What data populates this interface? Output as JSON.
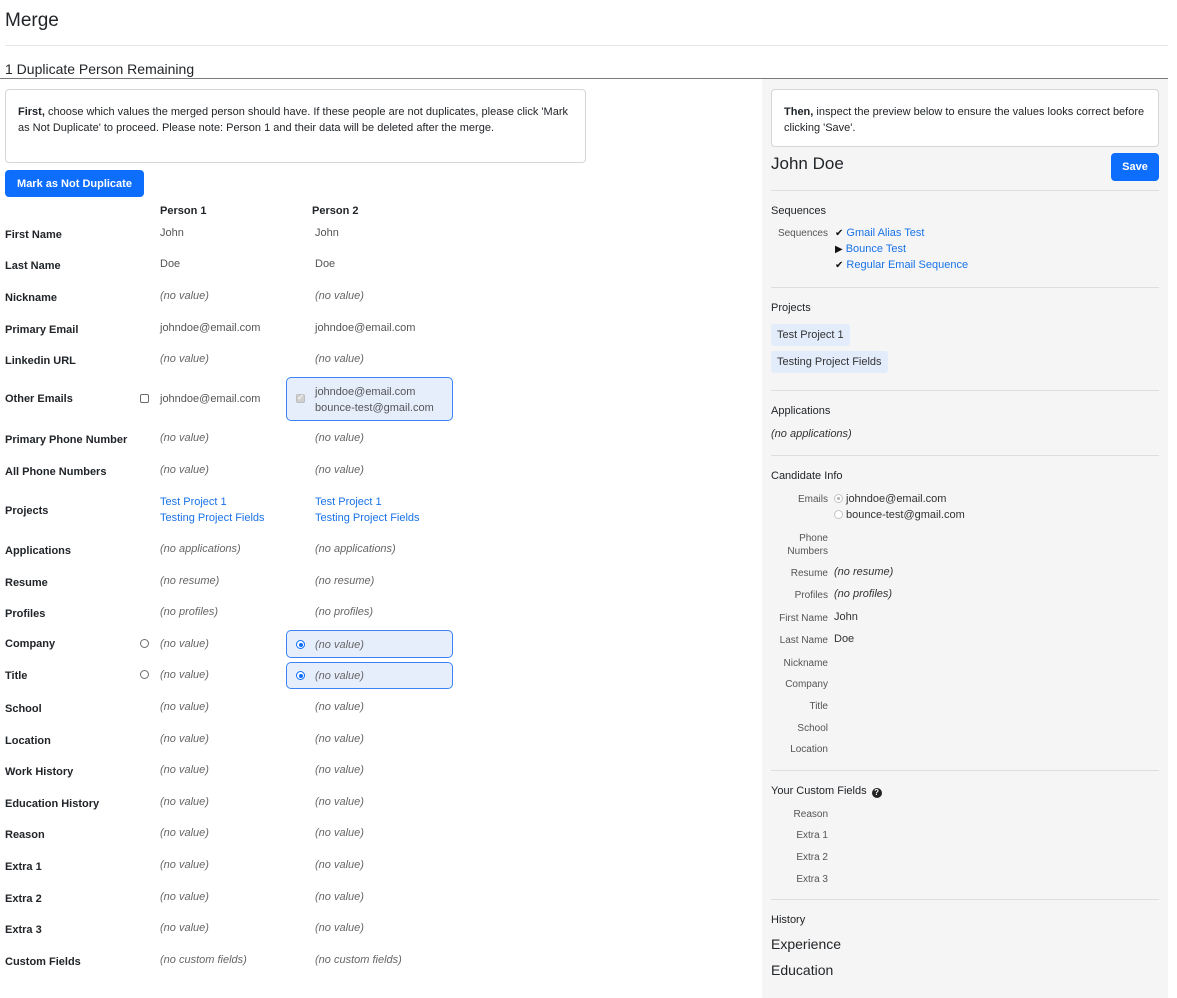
{
  "page": {
    "title": "Merge",
    "remaining": "1 Duplicate Person Remaining"
  },
  "instructions": {
    "lead": "First,",
    "text": " choose which values the merged person should have. If these people are not duplicates, please click 'Mark as Not Duplicate' to proceed. Please note: Person 1 and their data will be deleted after the merge."
  },
  "actions": {
    "mark_not_duplicate": "Mark as Not Duplicate",
    "save": "Save"
  },
  "columns": {
    "person1": "Person 1",
    "person2": "Person 2"
  },
  "fields": {
    "first_name": {
      "label": "First Name",
      "p1": "John",
      "p2": "John"
    },
    "last_name": {
      "label": "Last Name",
      "p1": "Doe",
      "p2": "Doe"
    },
    "nickname": {
      "label": "Nickname",
      "p1": "(no value)",
      "p2": "(no value)"
    },
    "primary_email": {
      "label": "Primary Email",
      "p1": "johndoe@email.com",
      "p2": "johndoe@email.com"
    },
    "linkedin_url": {
      "label": "Linkedin URL",
      "p1": "(no value)",
      "p2": "(no value)"
    },
    "other_emails": {
      "label": "Other Emails",
      "p1": "johndoe@email.com",
      "p2_line1": "johndoe@email.com",
      "p2_line2": "bounce-test@gmail.com"
    },
    "primary_phone": {
      "label": "Primary Phone Number",
      "p1": "(no value)",
      "p2": "(no value)"
    },
    "all_phones": {
      "label": "All Phone Numbers",
      "p1": "(no value)",
      "p2": "(no value)"
    },
    "projects": {
      "label": "Projects",
      "p1_a": "Test Project 1",
      "p1_b": "Testing Project Fields",
      "p2_a": "Test Project 1",
      "p2_b": "Testing Project Fields"
    },
    "applications": {
      "label": "Applications",
      "p1": "(no applications)",
      "p2": "(no applications)"
    },
    "resume": {
      "label": "Resume",
      "p1": "(no resume)",
      "p2": "(no resume)"
    },
    "profiles": {
      "label": "Profiles",
      "p1": "(no profiles)",
      "p2": "(no profiles)"
    },
    "company": {
      "label": "Company",
      "p1": "(no value)",
      "p2": "(no value)"
    },
    "title": {
      "label": "Title",
      "p1": "(no value)",
      "p2": "(no value)"
    },
    "school": {
      "label": "School",
      "p1": "(no value)",
      "p2": "(no value)"
    },
    "location": {
      "label": "Location",
      "p1": "(no value)",
      "p2": "(no value)"
    },
    "work_history": {
      "label": "Work History",
      "p1": "(no value)",
      "p2": "(no value)"
    },
    "education_history": {
      "label": "Education History",
      "p1": "(no value)",
      "p2": "(no value)"
    },
    "reason": {
      "label": "Reason",
      "p1": "(no value)",
      "p2": "(no value)"
    },
    "extra1": {
      "label": "Extra 1",
      "p1": "(no value)",
      "p2": "(no value)"
    },
    "extra2": {
      "label": "Extra 2",
      "p1": "(no value)",
      "p2": "(no value)"
    },
    "extra3": {
      "label": "Extra 3",
      "p1": "(no value)",
      "p2": "(no value)"
    },
    "custom_fields": {
      "label": "Custom Fields",
      "p1": "(no custom fields)",
      "p2": "(no custom fields)"
    }
  },
  "preview": {
    "then_lead": "Then,",
    "then_text": " inspect the preview below to ensure the values looks correct before clicking 'Save'.",
    "name": "John Doe",
    "sequences_title": "Sequences",
    "sequences_label": "Sequences",
    "sequences": [
      {
        "status": "check",
        "glyph": "✔",
        "name": "Gmail Alias Test"
      },
      {
        "status": "play",
        "glyph": "▶",
        "name": "Bounce Test"
      },
      {
        "status": "check",
        "glyph": "✔",
        "name": "Regular Email Sequence"
      }
    ],
    "projects_title": "Projects",
    "projects": [
      "Test Project 1",
      "Testing Project Fields"
    ],
    "applications_title": "Applications",
    "applications_value": "(no applications)",
    "candidate_title": "Candidate Info",
    "candidate": {
      "emails_label": "Emails",
      "email_1": "johndoe@email.com",
      "email_2": "bounce-test@gmail.com",
      "phone_label_1": "Phone",
      "phone_label_2": "Numbers",
      "resume_label": "Resume",
      "resume_value": "(no resume)",
      "profiles_label": "Profiles",
      "profiles_value": "(no profiles)",
      "first_name_label": "First Name",
      "first_name_value": "John",
      "last_name_label": "Last Name",
      "last_name_value": "Doe",
      "nickname_label": "Nickname",
      "company_label": "Company",
      "title_label": "Title",
      "school_label": "School",
      "location_label": "Location"
    },
    "custom_title": "Your Custom Fields",
    "custom": {
      "reason": "Reason",
      "extra1": "Extra 1",
      "extra2": "Extra 2",
      "extra3": "Extra 3"
    },
    "history_title": "History",
    "experience": "Experience",
    "education": "Education"
  },
  "colors": {
    "primary": "#0d6efd",
    "link": "#1a73e8",
    "selected_bg": "#e6eefc",
    "tag_bg": "#e3ecfb",
    "panel_bg": "#f5f5f5"
  }
}
